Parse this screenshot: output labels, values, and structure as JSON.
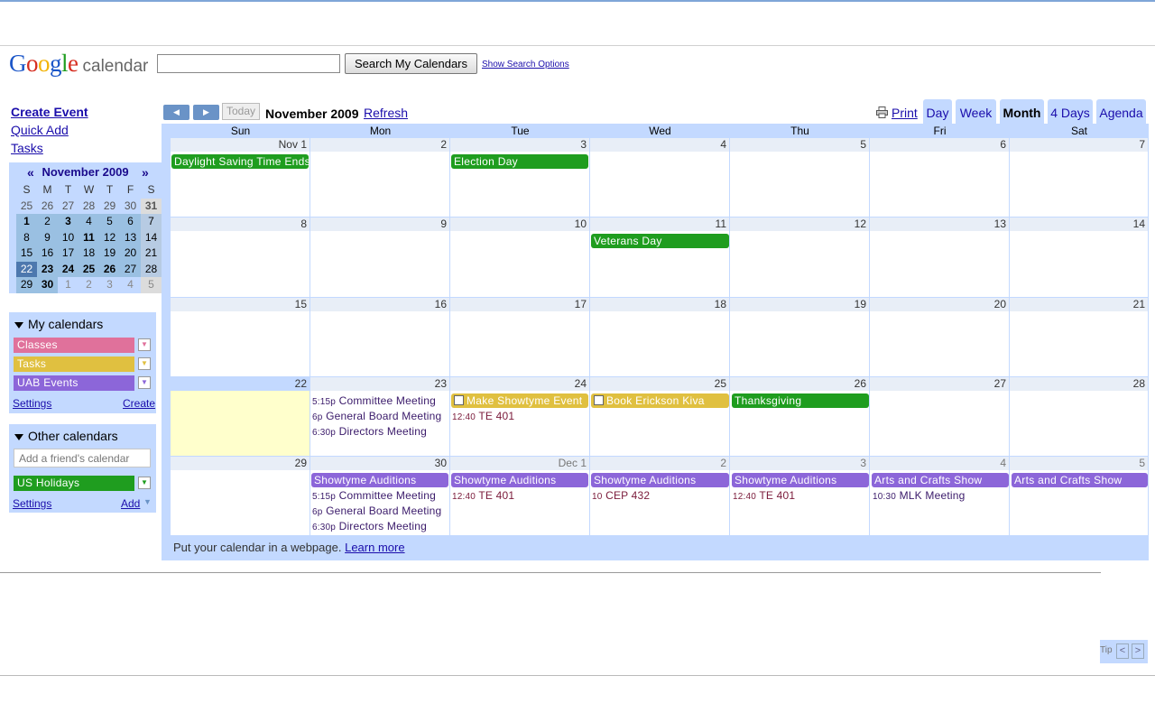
{
  "app": {
    "logo_word": "Google",
    "logo_sub": "calendar"
  },
  "search": {
    "placeholder": "",
    "button": "Search My Calendars",
    "options_link": "Show Search Options"
  },
  "sidebar": {
    "create_event": "Create Event",
    "quick_add": "Quick Add",
    "tasks": "Tasks"
  },
  "mini_calendar": {
    "title": "November 2009",
    "prev": "«",
    "next": "»",
    "dow": [
      "S",
      "M",
      "T",
      "W",
      "T",
      "F",
      "S"
    ],
    "weeks": [
      [
        "25",
        "26",
        "27",
        "28",
        "29",
        "30",
        "31"
      ],
      [
        "1",
        "2",
        "3",
        "4",
        "5",
        "6",
        "7"
      ],
      [
        "8",
        "9",
        "10",
        "11",
        "12",
        "13",
        "14"
      ],
      [
        "15",
        "16",
        "17",
        "18",
        "19",
        "20",
        "21"
      ],
      [
        "22",
        "23",
        "24",
        "25",
        "26",
        "27",
        "28"
      ],
      [
        "29",
        "30",
        "1",
        "2",
        "3",
        "4",
        "5"
      ]
    ]
  },
  "my_calendars": {
    "title": "My calendars",
    "items": [
      {
        "label": "Classes",
        "color": "#e0719b"
      },
      {
        "label": "Tasks",
        "color": "#e0c040"
      },
      {
        "label": "UAB Events",
        "color": "#8c66d9"
      }
    ],
    "settings": "Settings",
    "create": "Create"
  },
  "other_calendars": {
    "title": "Other calendars",
    "friend_placeholder": "Add a friend's calendar",
    "items": [
      {
        "label": "US Holidays",
        "color": "#1f9d1f"
      }
    ],
    "settings": "Settings",
    "add": "Add"
  },
  "toolbar": {
    "today": "Today",
    "month_title": "November 2009",
    "refresh": "Refresh",
    "print": "Print",
    "views": [
      "Day",
      "Week",
      "Month",
      "4 Days",
      "Agenda"
    ],
    "active_view": "Month"
  },
  "grid": {
    "dow": [
      "Sun",
      "Mon",
      "Tue",
      "Wed",
      "Thu",
      "Fri",
      "Sat"
    ],
    "weeks": [
      [
        "Nov 1",
        "2",
        "3",
        "4",
        "5",
        "6",
        "7"
      ],
      [
        "8",
        "9",
        "10",
        "11",
        "12",
        "13",
        "14"
      ],
      [
        "15",
        "16",
        "17",
        "18",
        "19",
        "20",
        "21"
      ],
      [
        "22",
        "23",
        "24",
        "25",
        "26",
        "27",
        "28"
      ],
      [
        "29",
        "30",
        "Dec 1",
        "2",
        "3",
        "4",
        "5"
      ]
    ]
  },
  "events": {
    "dst": "Daylight Saving Time Ends",
    "election": "Election Day",
    "veterans": "Veterans Day",
    "showtyme_event": "Make Showtyme Event",
    "erickson": "Book Erickson Kiva",
    "thanksgiving": "Thanksgiving",
    "mon23": [
      {
        "time": "5:15p",
        "title": "Committee Meeting"
      },
      {
        "time": "6p",
        "title": "General Board Meeting"
      },
      {
        "time": "6:30p",
        "title": "Directors Meeting"
      }
    ],
    "tue24": {
      "time": "12:40",
      "title": "TE 401"
    },
    "auditions": "Showtyme Auditions",
    "arts": "Arts and Crafts Show",
    "mon30": [
      {
        "time": "5:15p",
        "title": "Committee Meeting"
      },
      {
        "time": "6p",
        "title": "General Board Meeting"
      },
      {
        "time": "6:30p",
        "title": "Directors Meeting"
      }
    ],
    "dec1": {
      "time": "12:40",
      "title": "TE 401"
    },
    "dec2": {
      "time": "10",
      "title": "CEP 432"
    },
    "dec3": {
      "time": "12:40",
      "title": "TE 401"
    },
    "dec4": {
      "time": "10:30",
      "title": "MLK Meeting"
    }
  },
  "footer": {
    "text": "Put your calendar in a webpage.",
    "link": "Learn more"
  },
  "tip": {
    "label": "Tip",
    "prev": "<",
    "next": ">"
  },
  "colors": {
    "frame": "#c3d9ff",
    "purple": "#8c66d9",
    "green": "#1f9d1f",
    "yellow": "#e0c040",
    "maroon": "#7a1a3a"
  }
}
